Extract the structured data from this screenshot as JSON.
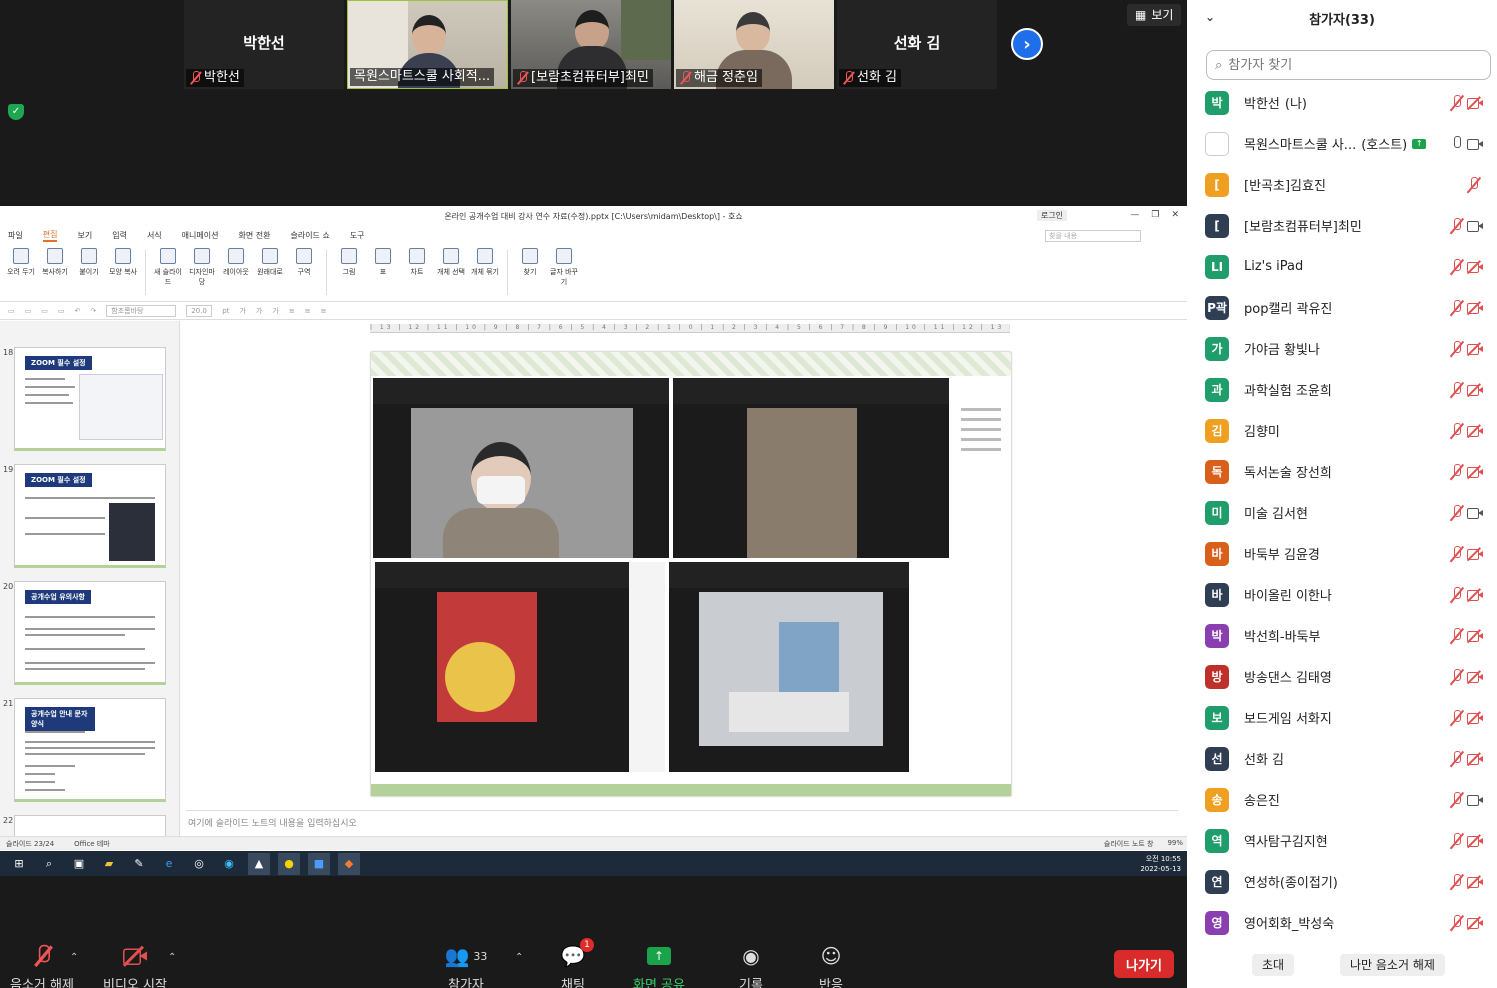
{
  "video_strip": {
    "tiles": [
      {
        "name": "박한선",
        "label": "박한선",
        "muted": true,
        "has_video": false
      },
      {
        "name": "목원스마트스쿨 사회적...",
        "label": "목원스마트스쿨 사회적...",
        "muted": false,
        "has_video": true
      },
      {
        "name": "[보람초컴퓨터부]최민",
        "label": "[보람초컴퓨터부]최민",
        "muted": true,
        "has_video": true
      },
      {
        "name": "해금 정춘임",
        "label": "해금 정춘임",
        "muted": true,
        "has_video": true
      },
      {
        "name": "선화 김",
        "label": "선화 김",
        "muted": true,
        "has_video": false
      }
    ],
    "view_label": "보기",
    "next_icon": "chevron-right-icon"
  },
  "share": {
    "window_title": "온라인 공개수업 대비 강사 연수 자료(수정).pptx [C:\\Users\\midam\\Desktop\\] - 호쇼",
    "login_label": "로그인",
    "menu": [
      "파일",
      "편집",
      "보기",
      "입력",
      "서식",
      "애니메이션",
      "화면 전환",
      "슬라이드 쇼",
      "도구"
    ],
    "menu_active": "편집",
    "search_placeholder": "찾을 내용",
    "ribbon": [
      "오려 두기",
      "복사하기",
      "붙이기",
      "모양 복사",
      "새 슬라이드",
      "디자인마당",
      "레이아웃",
      "원래대로",
      "구역",
      "그림",
      "표",
      "차트",
      "개체 선택",
      "개체 묶기",
      "찾기",
      "글자 바꾸기"
    ],
    "font_name": "함초롬바탕",
    "font_size": "20.0",
    "font_unit": "pt",
    "thumbs": [
      {
        "num": "18",
        "title": "ZOOM 필수 설정"
      },
      {
        "num": "19",
        "title": "ZOOM 필수 설정"
      },
      {
        "num": "20",
        "title": "공개수업 유의사항"
      },
      {
        "num": "21",
        "title": "공개수업 안내 문자 양식"
      },
      {
        "num": "22",
        "title": ""
      }
    ],
    "ruler": "| 13 | 12 | 11 | 10 | 9 | 8 | 7 | 6 | 5 | 4 | 3 | 2 | 1 | 0 | 1 | 2 | 3 | 4 | 5 | 6 | 7 | 8 | 9 | 10 | 11 | 12 | 13 |",
    "notes_placeholder": "여기에 슬라이드 노트의 내용을 입력하십시오",
    "status_slide": "슬라이드 23/24",
    "status_theme": "Office 테마",
    "status_notes": "슬라이드 노트 창",
    "status_zoom": "99%",
    "clock_time": "오전 10:55",
    "clock_date": "2022-05-13"
  },
  "toolbar": {
    "unmute": "음소거 해제",
    "start_video": "비디오 시작",
    "participants": "참가자",
    "participants_count": "33",
    "chat": "채팅",
    "chat_badge": "1",
    "share_screen": "화면 공유",
    "record": "기록",
    "reactions": "반응",
    "leave": "나가기"
  },
  "panel": {
    "title": "참가자(33)",
    "search_placeholder": "참가자 찾기",
    "participants": [
      {
        "initial": "박",
        "name": "박한선",
        "suffix": "(나)",
        "color": "#1f9d6b",
        "mic": "muted",
        "cam": "off"
      },
      {
        "initial": "",
        "name": "목원스마트스쿨 사...",
        "suffix": "(호스트)",
        "color": "#ffffff",
        "mic": "live",
        "cam": "on",
        "sharing": true
      },
      {
        "initial": "[",
        "name": "[반곡초]김효진",
        "suffix": "",
        "color": "#f0a020",
        "mic": "muted",
        "cam": "none"
      },
      {
        "initial": "[",
        "name": "[보람초컴퓨터부]최민",
        "suffix": "",
        "color": "#2f3e52",
        "mic": "muted",
        "cam": "on"
      },
      {
        "initial": "LI",
        "name": "Liz's iPad",
        "suffix": "",
        "color": "#1f9d6b",
        "mic": "muted",
        "cam": "off"
      },
      {
        "initial": "P곽",
        "name": "pop캘리 곽유진",
        "suffix": "",
        "color": "#2f3e52",
        "mic": "muted",
        "cam": "off"
      },
      {
        "initial": "가",
        "name": "가야금 황빛나",
        "suffix": "",
        "color": "#1f9d6b",
        "mic": "muted",
        "cam": "off"
      },
      {
        "initial": "과",
        "name": "과학실험 조윤희",
        "suffix": "",
        "color": "#1f9d6b",
        "mic": "muted",
        "cam": "off"
      },
      {
        "initial": "김",
        "name": "김향미",
        "suffix": "",
        "color": "#f0a020",
        "mic": "muted",
        "cam": "off"
      },
      {
        "initial": "독",
        "name": "독서논술 장선희",
        "suffix": "",
        "color": "#d9601a",
        "mic": "muted",
        "cam": "off"
      },
      {
        "initial": "미",
        "name": "미술 김서현",
        "suffix": "",
        "color": "#1f9d6b",
        "mic": "muted",
        "cam": "on"
      },
      {
        "initial": "바",
        "name": "바둑부 김윤경",
        "suffix": "",
        "color": "#d9601a",
        "mic": "muted",
        "cam": "off"
      },
      {
        "initial": "바",
        "name": "바이올린 이한나",
        "suffix": "",
        "color": "#2f3e52",
        "mic": "muted",
        "cam": "off"
      },
      {
        "initial": "박",
        "name": "박선희-바둑부",
        "suffix": "",
        "color": "#8a3fb0",
        "mic": "muted",
        "cam": "off"
      },
      {
        "initial": "방",
        "name": "방송댄스 김태영",
        "suffix": "",
        "color": "#c0302a",
        "mic": "muted",
        "cam": "off"
      },
      {
        "initial": "보",
        "name": "보드게임 서화지",
        "suffix": "",
        "color": "#1f9d6b",
        "mic": "muted",
        "cam": "off"
      },
      {
        "initial": "선",
        "name": "선화 김",
        "suffix": "",
        "color": "#2f3e52",
        "mic": "muted",
        "cam": "off"
      },
      {
        "initial": "송",
        "name": "송은진",
        "suffix": "",
        "color": "#f0a020",
        "mic": "muted",
        "cam": "on"
      },
      {
        "initial": "역",
        "name": "역사탐구김지현",
        "suffix": "",
        "color": "#1f9d6b",
        "mic": "muted",
        "cam": "off"
      },
      {
        "initial": "연",
        "name": "연성하(종이접기)",
        "suffix": "",
        "color": "#2f3e52",
        "mic": "muted",
        "cam": "off"
      },
      {
        "initial": "영",
        "name": "영어회화_박성숙",
        "suffix": "",
        "color": "#8a3fb0",
        "mic": "muted",
        "cam": "off"
      }
    ],
    "invite": "초대",
    "unmute_me": "나만 음소거 해제"
  }
}
